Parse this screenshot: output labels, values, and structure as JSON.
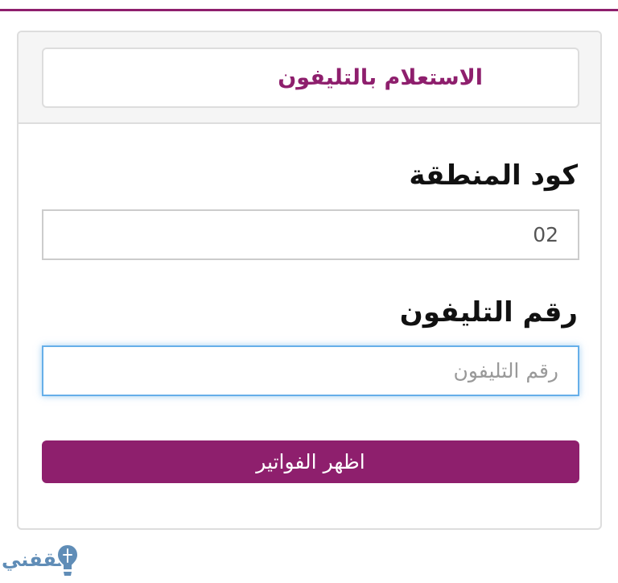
{
  "header": {
    "title": "الاستعلام بالتليفون"
  },
  "form": {
    "area_code_label": "كود المنطقة",
    "area_code_value": "02",
    "phone_label": "رقم التليفون",
    "phone_placeholder": "رقم التليفون",
    "submit_label": "اظهر الفواتير"
  },
  "watermark": {
    "text": "ثقفني",
    "icon": "lightbulb-icon"
  },
  "colors": {
    "brand": "#8e1f6d",
    "focus": "#66afe9",
    "watermark": "#1d5e9a"
  }
}
